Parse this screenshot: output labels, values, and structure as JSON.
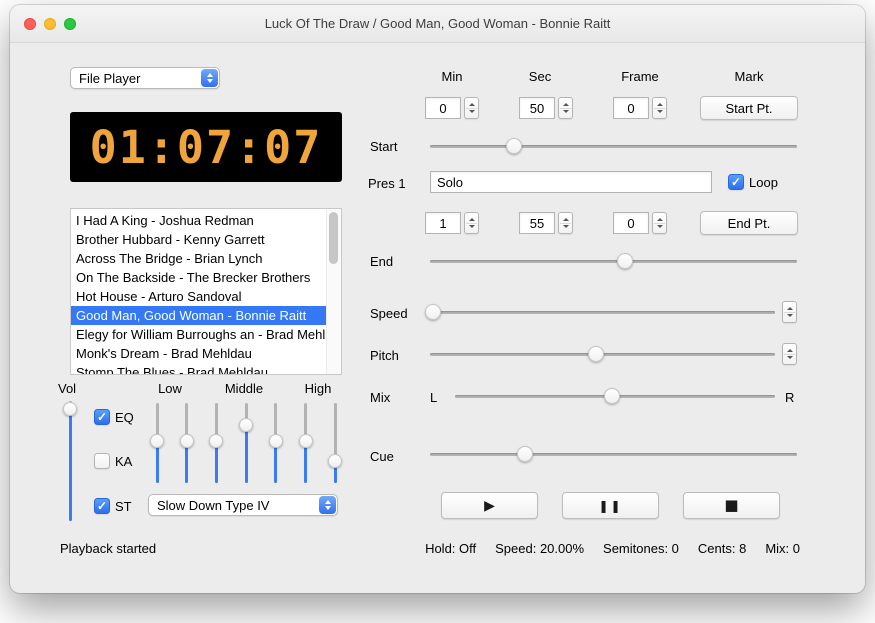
{
  "glyphs": {
    "check": "✓",
    "play": "▶",
    "pause": "❚❚",
    "stop": "■"
  },
  "colors": {
    "accent_blue": "#3b7cf5",
    "selection_blue": "#3478f6",
    "led_amber": "#efa43c"
  },
  "window": {
    "title": "Luck Of The Draw / Good Man, Good Woman - Bonnie Raitt"
  },
  "left_panel": {
    "mode_select": {
      "value": "File Player"
    },
    "time_display": "01:07:07",
    "playlist": [
      "I Had A King - Joshua Redman",
      "Brother Hubbard - Kenny Garrett",
      "Across The Bridge - Brian Lynch",
      "On The Backside - The Brecker Brothers",
      "Hot House - Arturo Sandoval",
      "Good Man, Good Woman - Bonnie Raitt",
      "Elegy for William Burroughs an - Brad Mehl",
      "Monk's Dream - Brad Mehldau",
      "Stomp The Blues - Brad Mehldau"
    ],
    "selected_index": 5,
    "vol_label": "Vol",
    "band_labels": [
      "Low",
      "Middle",
      "High"
    ],
    "checkboxes": [
      {
        "label": "EQ",
        "checked": true
      },
      {
        "label": "KA",
        "checked": false
      },
      {
        "label": "ST",
        "checked": true
      }
    ],
    "slowdown_select": {
      "value": "Slow Down Type IV"
    },
    "vol_value": 93,
    "eq_bands": [
      52,
      52,
      52,
      72,
      52,
      52,
      27
    ]
  },
  "right_panel": {
    "column_headers": [
      "Min",
      "Sec",
      "Frame",
      "Mark"
    ],
    "start_row": {
      "min": "0",
      "sec": "50",
      "frame": "0",
      "button_label": "Start Pt."
    },
    "end_row": {
      "min": "1",
      "sec": "55",
      "frame": "0",
      "button_label": "End Pt."
    },
    "row_labels": {
      "start": "Start",
      "pres": "Pres 1",
      "end": "End",
      "speed": "Speed",
      "pitch": "Pitch",
      "mix": "Mix",
      "cue": "Cue"
    },
    "pres_input": {
      "value": "Solo"
    },
    "loop_checkbox": {
      "label": "Loop",
      "checked": true
    },
    "mix_endpoints": {
      "left": "L",
      "right": "R"
    },
    "sliders": {
      "start": 23,
      "end": 53,
      "speed": 1,
      "pitch": 48,
      "mix": 49,
      "cue": 26
    }
  },
  "status_bar": {
    "message": "Playback started",
    "stats": [
      "Hold: Off",
      "Speed: 20.00%",
      "Semitones: 0",
      "Cents: 8",
      "Mix: 0"
    ]
  }
}
